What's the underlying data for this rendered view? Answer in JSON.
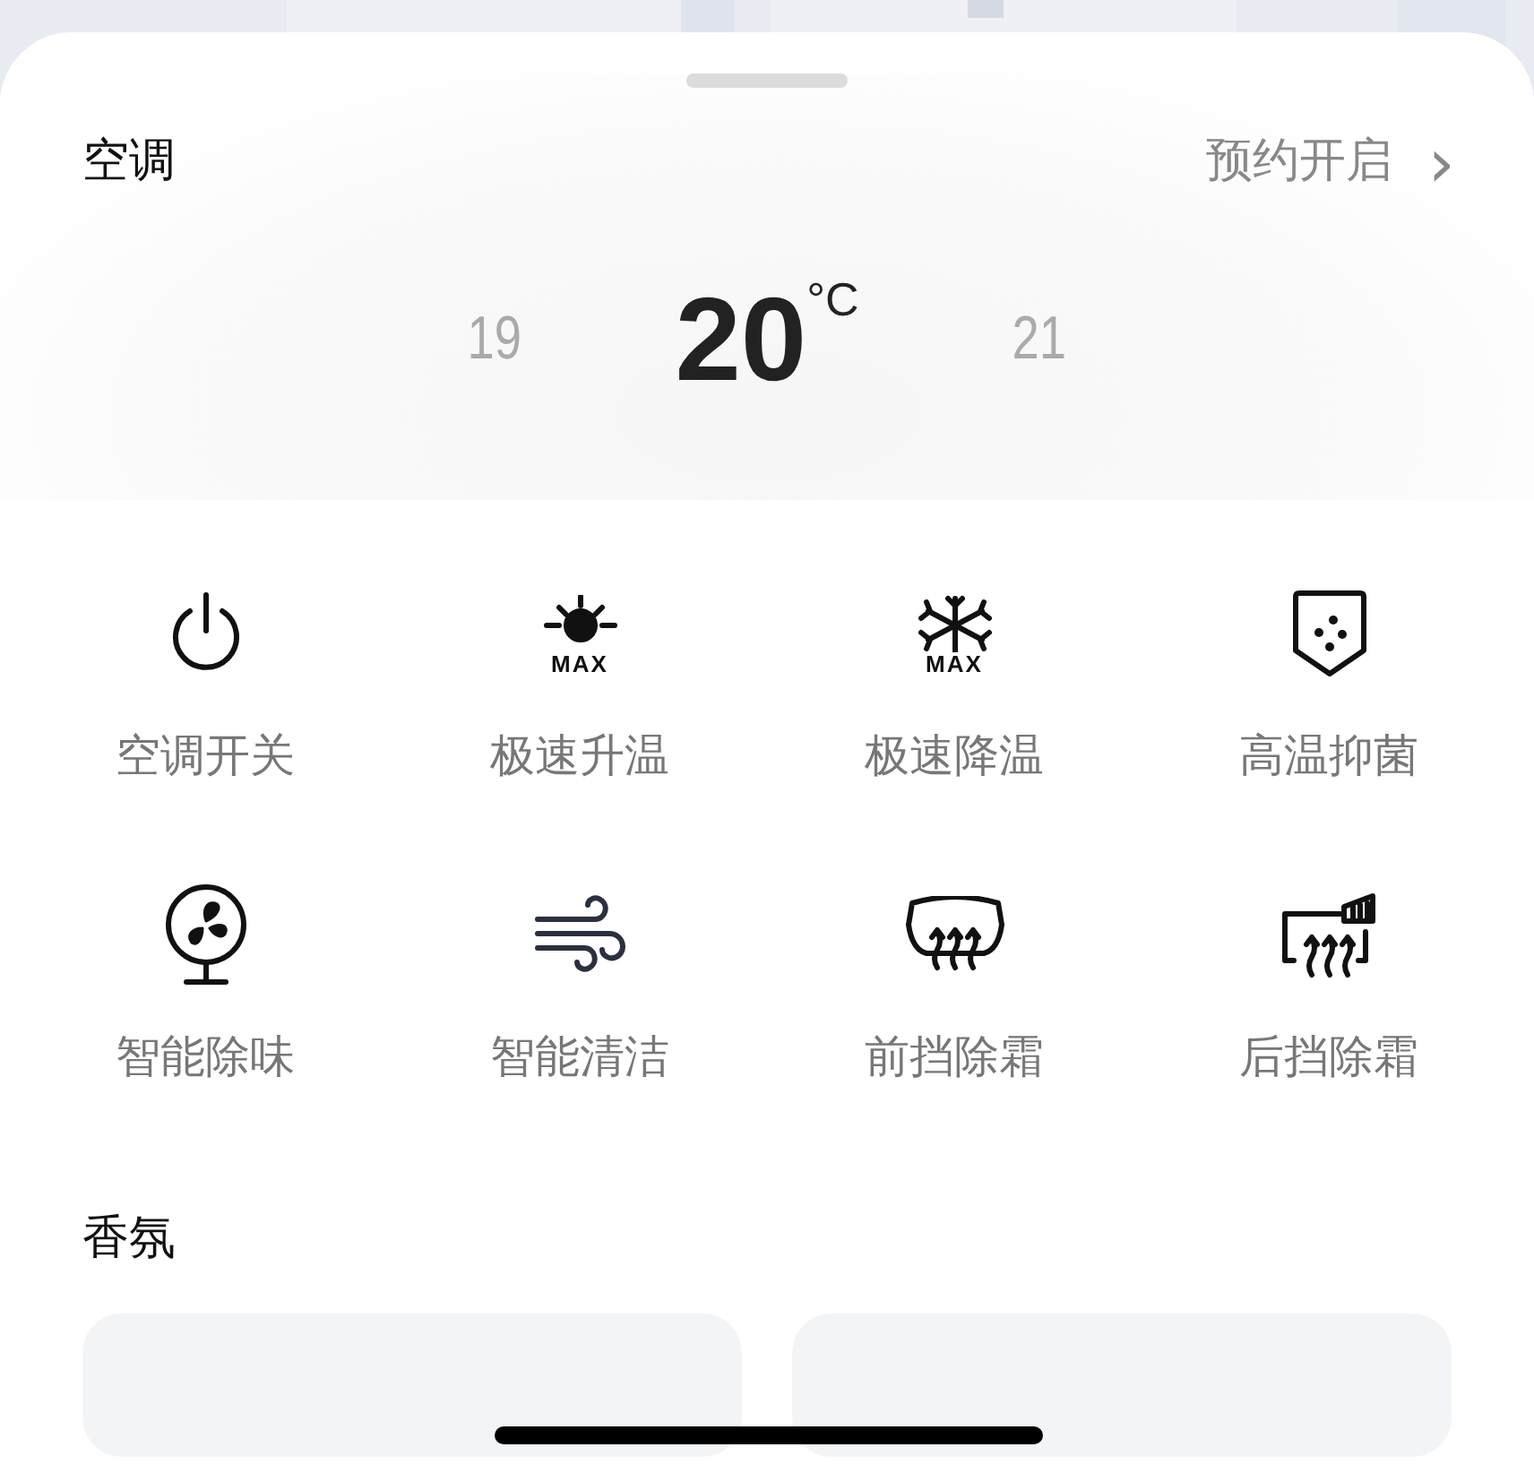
{
  "section_title": "空调",
  "schedule_link": {
    "label": "预约开启",
    "icon": "›"
  },
  "temperature": {
    "previous": "19",
    "current": "20",
    "unit": "°C",
    "next": "21"
  },
  "functions": [
    {
      "kind": "power",
      "label": "空调开关"
    },
    {
      "kind": "heat",
      "label": "极速升温",
      "badge": "MAX"
    },
    {
      "kind": "cool",
      "label": "极速降温",
      "badge": "MAX"
    },
    {
      "kind": "shield",
      "label": "高温抑菌"
    },
    {
      "kind": "fan",
      "label": "智能除味"
    },
    {
      "kind": "wind",
      "label": "智能清洁"
    },
    {
      "kind": "front_defrost",
      "label": "前挡除霜"
    },
    {
      "kind": "rear_defrost",
      "label": "后挡除霜"
    }
  ],
  "fragrance_title": "香氛",
  "fragrance_cards": [
    {
      "kind": "card"
    },
    {
      "kind": "card"
    }
  ]
}
